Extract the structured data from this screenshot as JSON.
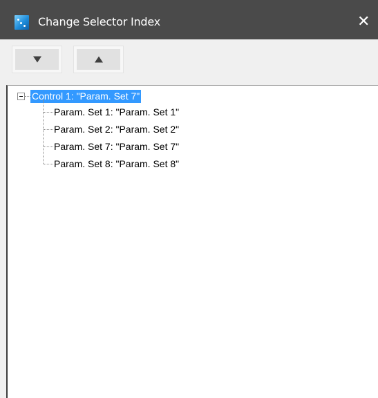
{
  "window": {
    "title": "Change Selector Index",
    "close_glyph": "✕"
  },
  "toolbar": {
    "down_button_icon": "triangle-down-icon",
    "up_button_icon": "triangle-up-icon"
  },
  "tree": {
    "root": {
      "label": "Control 1: \"Param. Set 7\"",
      "expanded": true,
      "selected": true
    },
    "children": [
      {
        "label": "Param. Set 1: \"Param. Set 1\""
      },
      {
        "label": "Param. Set 2: \"Param. Set 2\""
      },
      {
        "label": "Param. Set 7: \"Param. Set 7\""
      },
      {
        "label": "Param. Set 8: \"Param. Set 8\""
      }
    ]
  },
  "colors": {
    "titlebar": "#4a4a4a",
    "selection": "#3399ff",
    "toolbar": "#f0f0f0"
  }
}
